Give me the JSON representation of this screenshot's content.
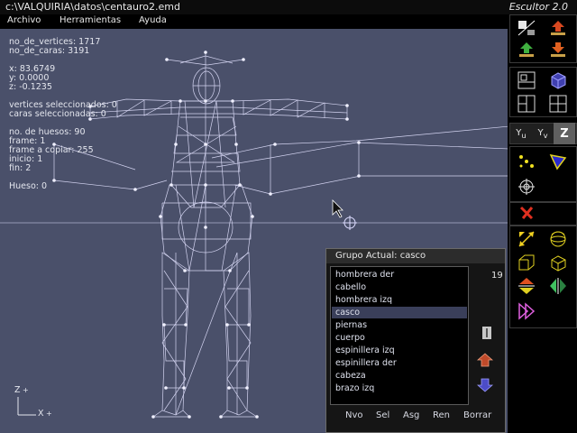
{
  "window": {
    "path": "c:\\VALQUIRIA\\datos\\centauro2.emd",
    "app_name": "Escultor 2.0"
  },
  "menu": [
    "Archivo",
    "Herramientas",
    "Ayuda"
  ],
  "info": {
    "vertices": "no_de_vertices: 1717",
    "caras": "no_de_caras: 3191",
    "x": "x: 83.6749",
    "y": "y: 0.0000",
    "z": "z: -0.1235",
    "vert_sel": "vertices seleccionados: 0",
    "caras_sel": "caras seleccionadas: 0",
    "huesos": "no. de huesos: 90",
    "frame": "frame: 1",
    "frame_copiar": "frame a copiar: 255",
    "inicio": "inicio: 1",
    "fin": "fin: 2",
    "hueso": "Hueso: 0"
  },
  "axes": {
    "z": "Z",
    "x": "X"
  },
  "group_panel": {
    "title": "Grupo Actual: casco",
    "count": "19",
    "items": [
      "hombrera der",
      "cabello",
      "hombrera izq",
      "casco",
      "piernas",
      "cuerpo",
      "espinillera izq",
      "espinillera der",
      "cabeza",
      "brazo izq"
    ],
    "selected_index": 3,
    "buttons": [
      "Nvo",
      "Sel",
      "Asg",
      "Ren",
      "Borrar"
    ]
  },
  "axis_buttons": [
    "u",
    "v",
    "Z"
  ],
  "colors": {
    "viewport": "#4a506a",
    "mesh": "#dcdcff",
    "selected_row": "#3a3f5a"
  }
}
